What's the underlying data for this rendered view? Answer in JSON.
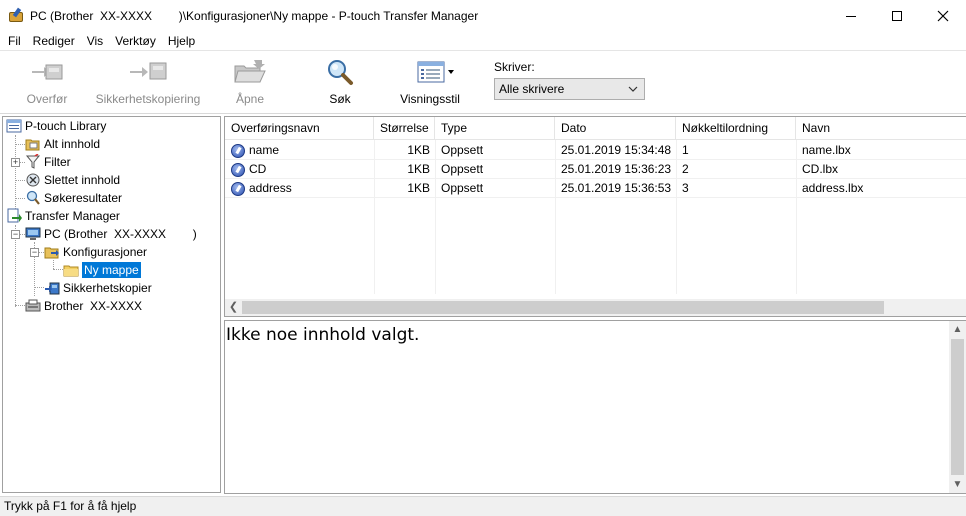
{
  "window": {
    "title": "PC (Brother  XX-XXXX        )\\Konfigurasjoner\\Ny mappe - P-touch Transfer Manager",
    "minimize": "—",
    "maximize": "☐",
    "close": "✕"
  },
  "menu": [
    {
      "label": "Fil"
    },
    {
      "label": "Rediger"
    },
    {
      "label": "Vis"
    },
    {
      "label": "Verktøy"
    },
    {
      "label": "Hjelp"
    }
  ],
  "toolbar": {
    "transfer": {
      "label": "Overfør",
      "icon": "transfer-icon",
      "enabled": false
    },
    "backup": {
      "label": "Sikkerhetskopiering",
      "icon": "backup-icon",
      "enabled": false
    },
    "open": {
      "label": "Åpne",
      "icon": "open-folder-icon",
      "enabled": false
    },
    "search": {
      "label": "Søk",
      "icon": "search-icon",
      "enabled": true
    },
    "view": {
      "label": "Visningsstil",
      "icon": "view-style-icon",
      "enabled": true
    },
    "printer": {
      "label": "Skriver:",
      "selected": "Alle skrivere"
    }
  },
  "tree": {
    "items": [
      {
        "label": "P-touch Library",
        "icon": "library-icon"
      },
      {
        "label": "Alt innhold",
        "icon": "all-content-icon"
      },
      {
        "label": "Filter",
        "icon": "filter-icon"
      },
      {
        "label": "Slettet innhold",
        "icon": "deleted-icon"
      },
      {
        "label": "Søkeresultater",
        "icon": "search-results-icon"
      },
      {
        "label": "Transfer Manager",
        "icon": "transfer-manager-icon"
      },
      {
        "label": "PC (Brother  XX-XXXX        )",
        "icon": "pc-icon"
      },
      {
        "label": "Konfigurasjoner",
        "icon": "configurations-icon"
      },
      {
        "label": "Ny mappe",
        "icon": "folder-icon"
      },
      {
        "label": "Sikkerhetskopier",
        "icon": "backups-icon"
      },
      {
        "label": "Brother  XX-XXXX",
        "icon": "printer-icon"
      }
    ]
  },
  "list": {
    "columns": [
      "Overføringsnavn",
      "Størrelse",
      "Type",
      "Dato",
      "Nøkkeltilordning",
      "Navn"
    ],
    "rows": [
      {
        "name": "name",
        "size": "1KB",
        "type": "Oppsett",
        "date": "25.01.2019 15:34:48",
        "key": "1",
        "file": "name.lbx"
      },
      {
        "name": "CD",
        "size": "1KB",
        "type": "Oppsett",
        "date": "25.01.2019 15:36:23",
        "key": "2",
        "file": "CD.lbx"
      },
      {
        "name": "address",
        "size": "1KB",
        "type": "Oppsett",
        "date": "25.01.2019 15:36:53",
        "key": "3",
        "file": "address.lbx"
      }
    ]
  },
  "preview": {
    "text": "Ikke noe innhold valgt."
  },
  "status": {
    "text": "Trykk på F1 for å få hjelp"
  }
}
